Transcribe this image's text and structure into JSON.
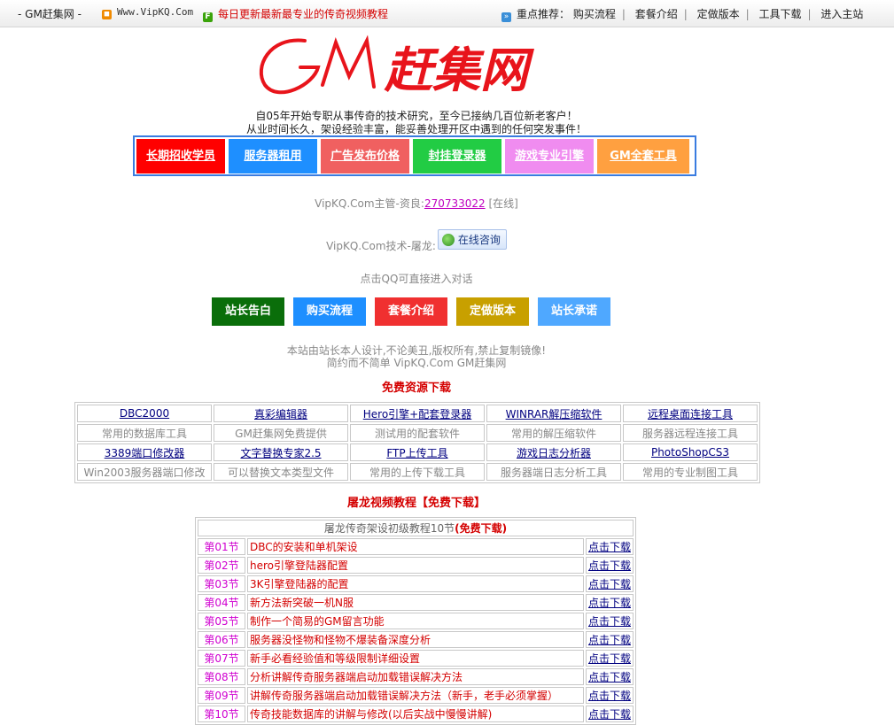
{
  "topbar": {
    "home": "- GM赶集网 -",
    "site": "Www.VipKQ.Com",
    "news": "每日更新最新最专业的传奇视频教程",
    "rec_label": "重点推荐：",
    "nav": [
      "购买流程",
      "套餐介绍",
      "定做版本",
      "工具下载",
      "进入主站"
    ]
  },
  "logo": {
    "text": "GM赶集网",
    "color": "#e8141b"
  },
  "intro": [
    "自05年开始专职从事传奇的技术研究，至今已接纳几百位新老客户！",
    "从业时间长久，架设经验丰富，能妥善处理开区中遇到的任何突发事件！"
  ],
  "menu": [
    {
      "label": "长期招收学员",
      "color": "#ff0000"
    },
    {
      "label": "服务器租用",
      "color": "#1e8fff"
    },
    {
      "label": "广告发布价格",
      "color": "#f06060"
    },
    {
      "label": "封挂登录器",
      "color": "#22cc44"
    },
    {
      "label": "游戏专业引擎",
      "color": "#f08cf0"
    },
    {
      "label": "GM全套工具",
      "color": "#ffa040"
    }
  ],
  "contact": {
    "boss_prefix": "VipKQ.Com主管-资良:",
    "boss_qq": "270733022",
    "boss_status": "[在线]",
    "tech_prefix": "VipKQ.Com技术-屠龙:",
    "consult": "在线咨询",
    "hint": "点击QQ可直接进入对话"
  },
  "buttons": [
    {
      "label": "站长告白",
      "color": "#0a6e0a"
    },
    {
      "label": "购买流程",
      "color": "#1e8fff"
    },
    {
      "label": "套餐介绍",
      "color": "#f03030"
    },
    {
      "label": "定做版本",
      "color": "#c8a000"
    },
    {
      "label": "站长承诺",
      "color": "#4fa8ff"
    }
  ],
  "copyright": [
    "本站由站长本人设计,不论美丑,版权所有,禁止复制镜像!",
    "简约而不简单 VipKQ.Com GM赶集网"
  ],
  "free_title": "免费资源下载",
  "tools": [
    {
      "name": "DBC2000",
      "desc": "常用的数据库工具"
    },
    {
      "name": "真彩编辑器",
      "desc": "GM赶集网免费提供"
    },
    {
      "name": "Hero引擎+配套登录器",
      "desc": "测试用的配套软件"
    },
    {
      "name": "WINRAR解压缩软件",
      "desc": "常用的解压缩软件"
    },
    {
      "name": "远程桌面连接工具",
      "desc": "服务器远程连接工具"
    },
    {
      "name": "3389端口修改器",
      "desc": "Win2003服务器端口修改"
    },
    {
      "name": "文字替换专家2.5",
      "desc": "可以替换文本类型文件"
    },
    {
      "name": "FTP上传工具",
      "desc": "常用的上传下载工具"
    },
    {
      "name": "游戏日志分析器",
      "desc": "服务器端日志分析工具"
    },
    {
      "name": "PhotoShopCS3",
      "desc": "常用的专业制图工具"
    }
  ],
  "video_title": "屠龙视频教程【免费下载】",
  "tutorial": {
    "header": "屠龙传奇架设初级教程10节",
    "header_tag": "(免费下载)",
    "download_label": "点击下载",
    "lessons": [
      {
        "ep": "第01节",
        "title": "DBC的安装和单机架设"
      },
      {
        "ep": "第02节",
        "title": "hero引擎登陆器配置"
      },
      {
        "ep": "第03节",
        "title": "3K引擎登陆器的配置"
      },
      {
        "ep": "第04节",
        "title": "新方法新突破一机N服"
      },
      {
        "ep": "第05节",
        "title": "制作一个简易的GM留言功能"
      },
      {
        "ep": "第06节",
        "title": "服务器没怪物和怪物不爆装备深度分析"
      },
      {
        "ep": "第07节",
        "title": "新手必看经验值和等级限制详细设置"
      },
      {
        "ep": "第08节",
        "title": "分析讲解传奇服务器端启动加载错误解决方法"
      },
      {
        "ep": "第09节",
        "title": "讲解传奇服务器端启动加载错误解决方法（新手，老手必须掌握）"
      },
      {
        "ep": "第10节",
        "title": "传奇技能数据库的讲解与修改(以后实战中慢慢讲解)"
      }
    ]
  }
}
